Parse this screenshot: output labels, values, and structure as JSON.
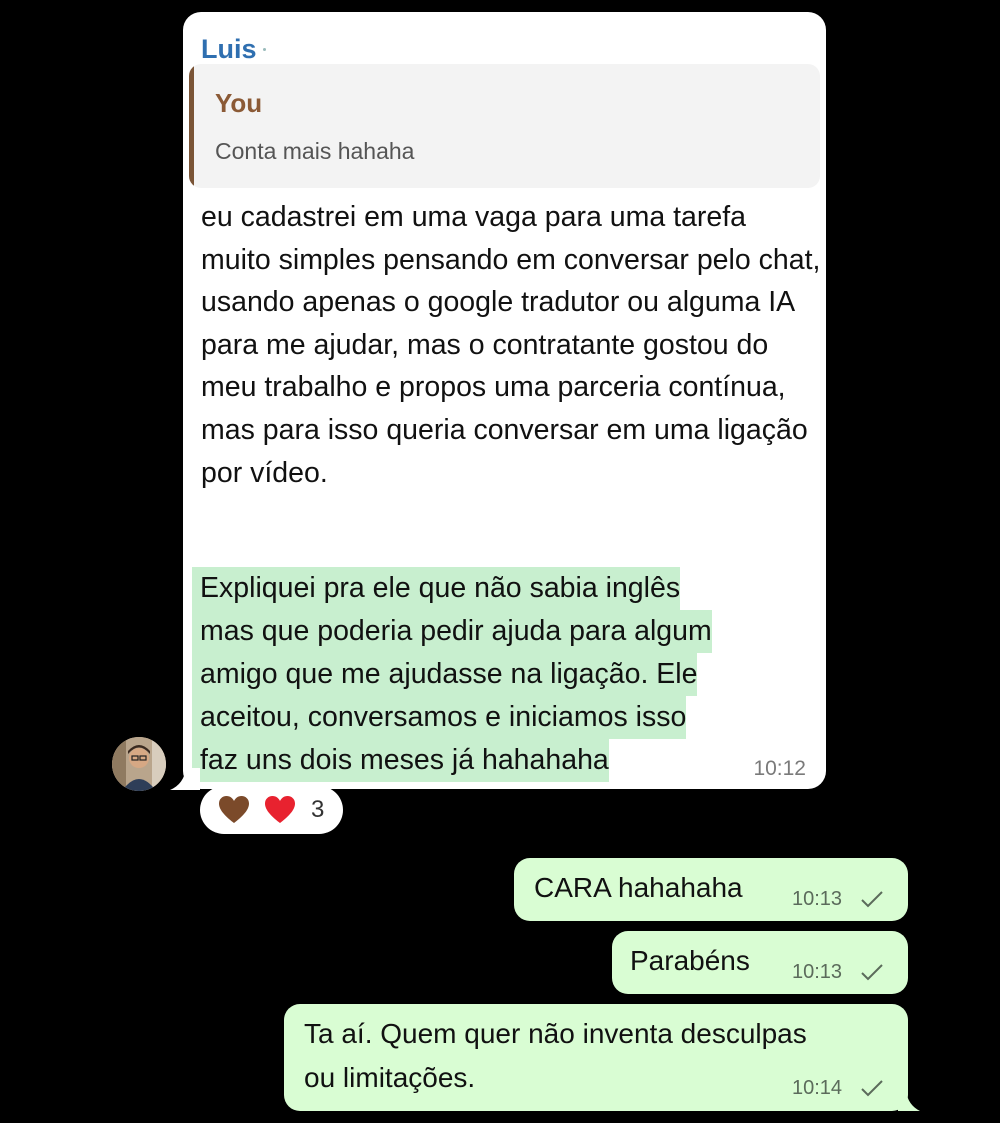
{
  "incoming": {
    "sender": "Luis",
    "quote": {
      "author": "You",
      "text": "Conta mais hahaha"
    },
    "paragraph1": "eu cadastrei em uma vaga para uma tarefa muito simples pensando em conversar pelo chat, usando apenas o google tradutor ou alguma IA para me ajudar, mas o contratante gostou do meu trabalho e propos uma parceria contínua, mas para isso queria conversar em uma ligação por vídeo.",
    "paragraph2_lines": [
      "Expliquei pra ele que não sabia inglês",
      "mas que poderia pedir ajuda para algum",
      "amigo que me ajudasse na ligação. Ele",
      "aceitou, conversamos e iniciamos isso",
      "faz uns dois meses já hahahaha"
    ],
    "time": "10:12",
    "reactions": {
      "icons": [
        "brown-heart-icon",
        "red-heart-icon"
      ],
      "count": "3"
    }
  },
  "outgoing": [
    {
      "text": "CARA hahahaha",
      "time": "10:13"
    },
    {
      "text": "Parabéns",
      "time": "10:13"
    },
    {
      "text_lines": [
        "Ta aí. Quem quer não inventa desculpas",
        "ou limitações."
      ],
      "time": "10:14"
    }
  ],
  "colors": {
    "background": "#000000",
    "incoming_bubble": "#ffffff",
    "outgoing_bubble": "#d9fdd3",
    "highlight": "#c8efcf",
    "sender_name": "#2f6fb0",
    "quote_accent": "#7a5436"
  }
}
